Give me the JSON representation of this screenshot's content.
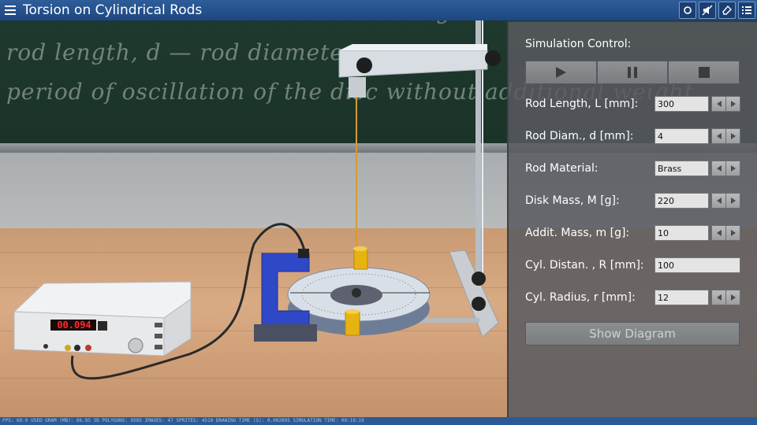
{
  "app": {
    "title": "Torsion on Cylindrical Rods"
  },
  "toolbar": {
    "buttons": [
      "refresh-icon",
      "mute-icon",
      "eraser-icon",
      "list-icon"
    ]
  },
  "chalkboard": {
    "lines": [
      "— additional weight mass",
      "rod length, d — rod diameter",
      "period of oscillation of the disc without additional weight"
    ]
  },
  "timer_display": {
    "value": "00.094"
  },
  "panel": {
    "heading": "Simulation Control:",
    "controls": [
      "play-icon",
      "pause-icon",
      "stop-icon"
    ],
    "params": [
      {
        "label": "Rod Length, L [mm]:",
        "value": "300",
        "spinner": true
      },
      {
        "label": "Rod Diam., d [mm]:",
        "value": "4",
        "spinner": true
      },
      {
        "label": "Rod Material:",
        "value": "Brass",
        "spinner": true
      },
      {
        "label": "Disk Mass, M [g]:",
        "value": "220",
        "spinner": true
      },
      {
        "label": "Addit. Mass, m [g]:",
        "value": "10",
        "spinner": true
      },
      {
        "label": "Cyl. Distan. , R [mm]:",
        "value": "100",
        "spinner": false
      },
      {
        "label": "Cyl. Radius, r [mm]:",
        "value": "12",
        "spinner": true
      }
    ],
    "show_diagram_label": "Show Diagram"
  },
  "statusbar": {
    "text": "FPS: 60.0 USED GRAM (MB): 86.95 3D POLYGONS: 9585 IMAGES: 47 SPRITES: 4510 DRAWING TIME (S): 0.002895 SIMULATION TIME: 00:18:19"
  },
  "colors": {
    "title_bar": "#1d4780",
    "panel_bg": "#585a60",
    "chalkboard": "#1f3a30",
    "desk": "#d4a47d",
    "rod_wire": "#e0a53a",
    "led_digits": "#ff2a2a"
  }
}
